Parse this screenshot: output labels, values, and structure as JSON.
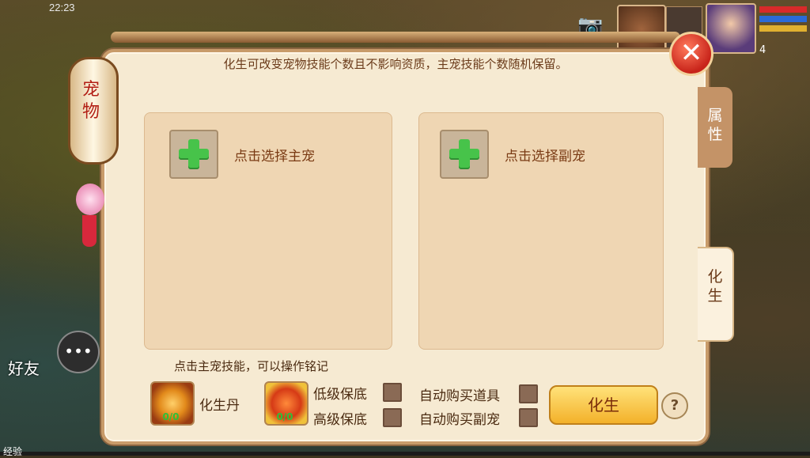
{
  "status_bar": {
    "time": "22:23"
  },
  "panel": {
    "hint_top": "化生可改变宠物技能个数且不影响资质，主宠技能个数随机保留。",
    "main_slot_label": "点击选择主宠",
    "sub_slot_label": "点击选择副宠",
    "hint_bottom": "点击主宠技能，可以操作铭记"
  },
  "lantern": {
    "title_1": "宠",
    "title_2": "物"
  },
  "tabs": {
    "attributes": "属性",
    "rebirth": "化生"
  },
  "items": {
    "pill_label": "化生丹",
    "pill_count": "0/0",
    "guarantee_count": "0/0",
    "low_guarantee": "低级保底",
    "high_guarantee": "高级保底",
    "auto_buy_item": "自动购买道具",
    "auto_buy_sub_pet": "自动购买副宠"
  },
  "buttons": {
    "rebirth": "化生",
    "help": "?",
    "close": "✕"
  },
  "hud": {
    "friends": "好友",
    "exp_label": "经验",
    "level": "4"
  }
}
